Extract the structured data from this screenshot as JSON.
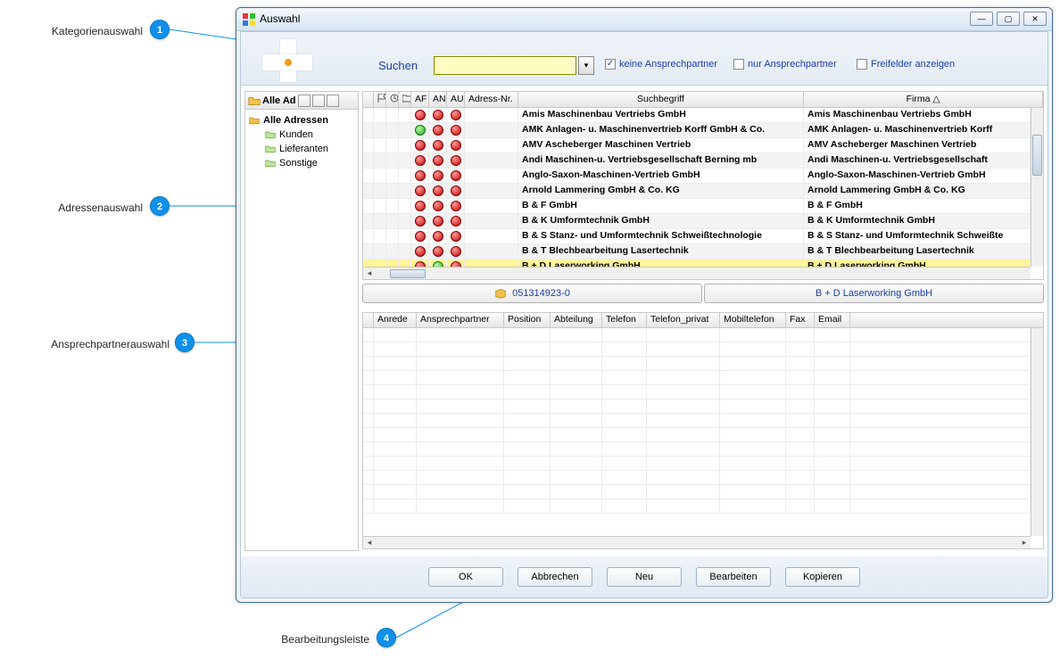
{
  "annotations": {
    "a1": "Kategorienauswahl",
    "a2": "Adressenauswahl",
    "a3": "Ansprechpartnerauswahl",
    "a4": "Bearbeitungsleiste"
  },
  "window": {
    "title": "Auswahl"
  },
  "toolbar": {
    "search_label": "Suchen",
    "chk1_label": "keine Ansprechpartner",
    "chk1_checked": true,
    "chk2_label": "nur Ansprechpartner",
    "chk2_checked": false,
    "chk3_label": "Freifelder anzeigen",
    "chk3_checked": false
  },
  "tree": {
    "header": "Alle Ad",
    "root": "Alle Adressen",
    "children": [
      "Kunden",
      "Lieferanten",
      "Sonstige"
    ]
  },
  "grid": {
    "columns": {
      "c_af": "AF",
      "c_an": "AN",
      "c_au": "AU",
      "c_nr": "Adress-Nr.",
      "c_such": "Suchbegriff",
      "c_firma": "Firma △"
    },
    "rows": [
      {
        "af": "r",
        "an": "r",
        "au": "r",
        "nr": "",
        "such": "Amis Maschinenbau Vertriebs GmbH",
        "firma": "Amis Maschinenbau Vertriebs GmbH"
      },
      {
        "af": "g",
        "an": "r",
        "au": "r",
        "nr": "",
        "such": "AMK Anlagen- u. Maschinenvertrieb Korff GmbH & Co.",
        "firma": "AMK Anlagen- u. Maschinenvertrieb Korff"
      },
      {
        "af": "r",
        "an": "r",
        "au": "r",
        "nr": "",
        "such": "AMV Ascheberger Maschinen Vertrieb",
        "firma": "AMV Ascheberger Maschinen Vertrieb"
      },
      {
        "af": "r",
        "an": "r",
        "au": "r",
        "nr": "",
        "such": "Andi Maschinen-u. Vertriebsgesellschaft Berning mb",
        "firma": "Andi Maschinen-u. Vertriebsgesellschaft"
      },
      {
        "af": "r",
        "an": "r",
        "au": "r",
        "nr": "",
        "such": "Anglo-Saxon-Maschinen-Vertrieb GmbH",
        "firma": "Anglo-Saxon-Maschinen-Vertrieb GmbH"
      },
      {
        "af": "r",
        "an": "r",
        "au": "r",
        "nr": "",
        "such": "Arnold Lammering GmbH & Co. KG",
        "firma": "Arnold Lammering GmbH & Co. KG"
      },
      {
        "af": "r",
        "an": "r",
        "au": "r",
        "nr": "",
        "such": "B & F GmbH",
        "firma": "B & F GmbH"
      },
      {
        "af": "r",
        "an": "r",
        "au": "r",
        "nr": "",
        "such": "B & K Umformtechnik GmbH",
        "firma": "B & K Umformtechnik GmbH"
      },
      {
        "af": "r",
        "an": "r",
        "au": "r",
        "nr": "",
        "such": "B & S Stanz- und Umformtechnik Schweißtechnologie",
        "firma": "B & S Stanz- und Umformtechnik Schweißte"
      },
      {
        "af": "r",
        "an": "r",
        "au": "r",
        "nr": "",
        "such": "B & T Blechbearbeitung Lasertechnik",
        "firma": "B & T Blechbearbeitung Lasertechnik"
      },
      {
        "af": "r",
        "an": "g",
        "au": "r",
        "nr": "",
        "such": "B + D Laserworking GmbH",
        "firma": "B + D Laserworking GmbH",
        "sel": true
      }
    ]
  },
  "caption": {
    "left": "051314923-0",
    "right": "B + D Laserworking GmbH"
  },
  "cgrid": {
    "columns": [
      "Anrede",
      "Ansprechpartner",
      "Position",
      "Abteilung",
      "Telefon",
      "Telefon_privat",
      "Mobiltelefon",
      "Fax",
      "Email"
    ]
  },
  "buttons": {
    "ok": "OK",
    "cancel": "Abbrechen",
    "new": "Neu",
    "edit": "Bearbeiten",
    "copy": "Kopieren"
  }
}
